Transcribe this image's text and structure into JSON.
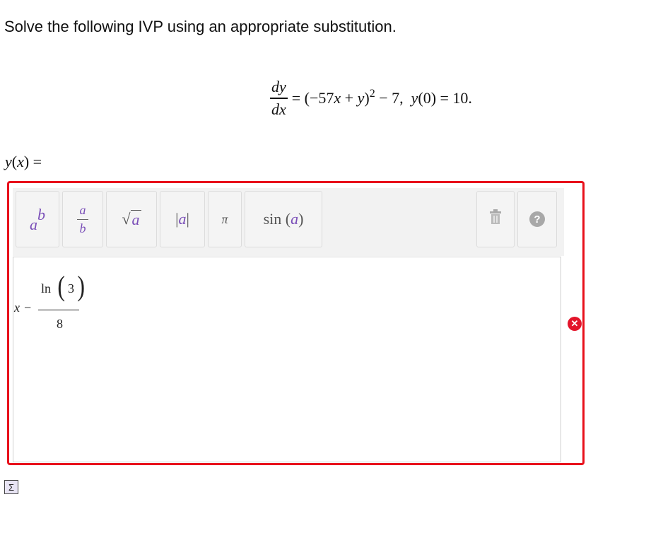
{
  "question": {
    "text": "Solve the following IVP using an appropriate substitution."
  },
  "equation": {
    "dy": "dy",
    "dx": "dx",
    "rhs": "= (−57",
    "rhs_x": "x",
    "rhs_mid": " + ",
    "rhs_y": "y",
    "rhs_close": ")",
    "exponent": "2",
    "rhs_tail": " − 7,  ",
    "ic_y": "y",
    "ic_rest": "(0) = 10."
  },
  "answer_label": {
    "y": "y",
    "open": "(",
    "x": "x",
    "close": ") ="
  },
  "toolbar": {
    "power": {
      "base": "a",
      "exp": "b"
    },
    "fraction": {
      "num": "a",
      "den": "b"
    },
    "sqrt": {
      "symbol": "√",
      "arg": "a"
    },
    "abs": {
      "left": "|",
      "arg": "a",
      "right": "|"
    },
    "pi": "π",
    "sin": {
      "fn": "sin",
      "open": " (",
      "arg": "a",
      "close": ")"
    },
    "help": "?"
  },
  "answer_expression": {
    "x": "x",
    "minus": "−",
    "ln": "ln",
    "arg": "3",
    "denominator": "8"
  },
  "status": {
    "error_symbol": "✕"
  },
  "colors": {
    "error_border": "#e8101b",
    "accent_var": "#7a4fb8"
  },
  "icons": [
    "trash-icon",
    "help-icon",
    "error-icon",
    "sigma-icon"
  ]
}
